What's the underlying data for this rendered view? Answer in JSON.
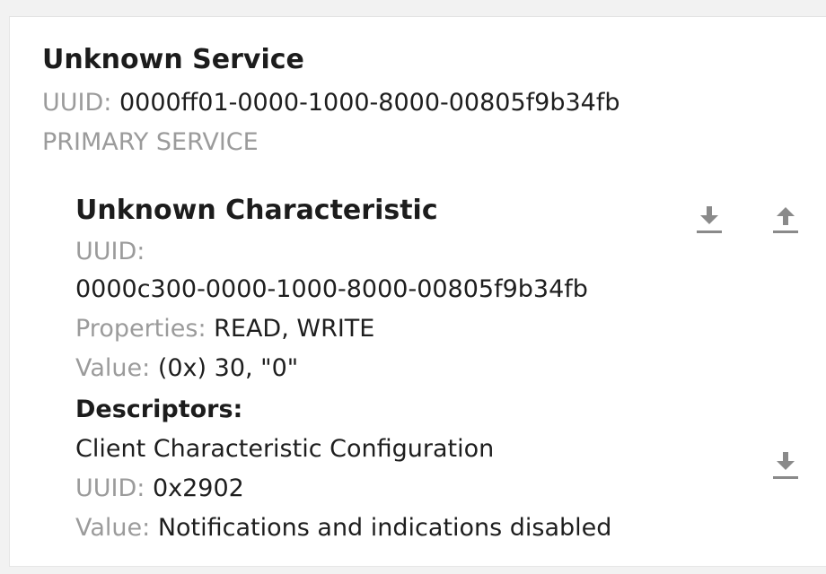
{
  "service": {
    "title": "Unknown Service",
    "uuid_label": "UUID: ",
    "uuid_value": "0000ff01-0000-1000-8000-00805f9b34fb",
    "type": "PRIMARY SERVICE"
  },
  "characteristic": {
    "title": "Unknown Characteristic",
    "uuid_label": "UUID:",
    "uuid_value": "0000c300-0000-1000-8000-00805f9b34fb",
    "properties_label": "Properties: ",
    "properties_value": "READ, WRITE",
    "value_label": "Value: ",
    "value_value": "(0x) 30, \"0\"",
    "read_icon": "download-arrow-icon",
    "write_icon": "upload-arrow-icon"
  },
  "descriptors": {
    "title": "Descriptors:",
    "name": "Client Characteristic Configuration",
    "uuid_label": "UUID: ",
    "uuid_value": "0x2902",
    "value_label": "Value: ",
    "value_value": "Notifications and indications disabled",
    "read_icon": "download-arrow-icon"
  },
  "colors": {
    "label": "#9b9b9b",
    "text": "#1e1e1e",
    "icon": "#8a8a8a"
  }
}
